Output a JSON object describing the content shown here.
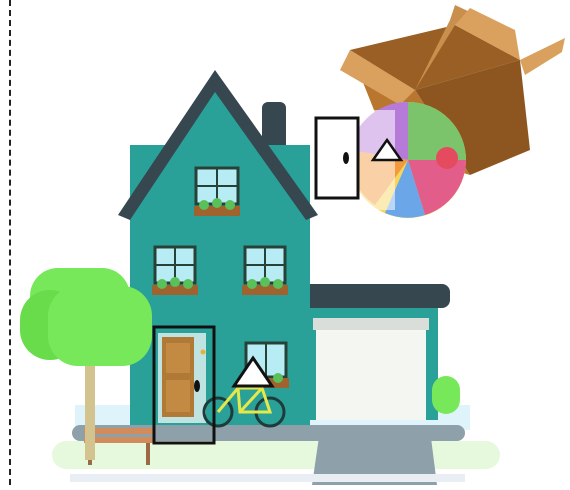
{
  "scene": {
    "description_labels": [],
    "colors": {
      "house_wall": "#2aa198",
      "house_roof": "#37474f",
      "garage_roof": "#37474f",
      "garage_door": "#f4f6f2",
      "box": "#b8762f",
      "ball_pink": "#e35d8a",
      "ball_orange": "#f39a3c",
      "ball_yellow": "#f6d55c",
      "ball_blue": "#6aa6e8",
      "ball_purple": "#b67ad9",
      "ball_green": "#7bc46b",
      "tree": "#77e85a",
      "bike_frame": "#e5e84a",
      "door": "#b07a36",
      "ground_pale": "#dff3fb",
      "path": "#8ea0aa",
      "selection_frame": "#111111"
    },
    "icons": [
      "triangle-marker-icon",
      "triangle-marker-icon",
      "eye-dot-icon",
      "eye-dot-icon"
    ]
  }
}
